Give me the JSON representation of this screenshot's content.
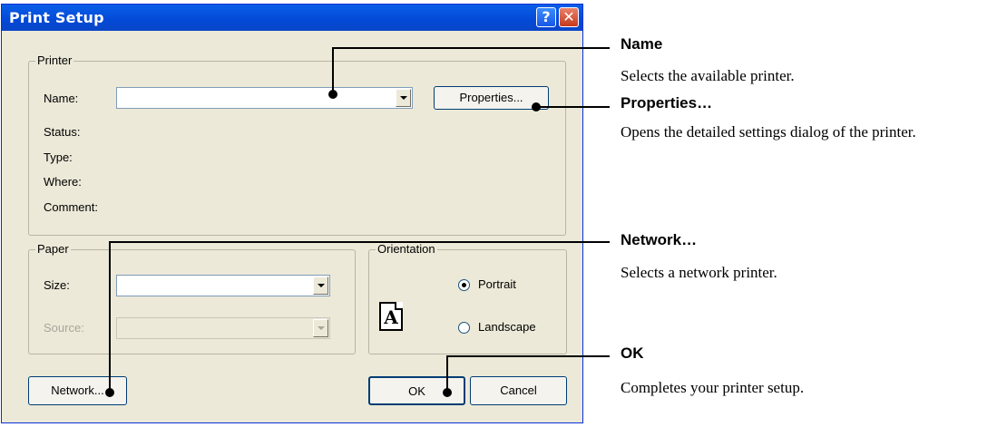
{
  "dialog": {
    "title": "Print Setup",
    "help_glyph": "?",
    "close_glyph": "✕"
  },
  "printer": {
    "group_label": "Printer",
    "name_label": "Name:",
    "name_value": "",
    "properties_label": "Properties...",
    "status_label": "Status:",
    "type_label": "Type:",
    "where_label": "Where:",
    "comment_label": "Comment:"
  },
  "paper": {
    "group_label": "Paper",
    "size_label": "Size:",
    "size_value": "",
    "source_label": "Source:",
    "source_value": ""
  },
  "orientation": {
    "group_label": "Orientation",
    "portrait_label": "Portrait",
    "landscape_label": "Landscape",
    "selected": "Portrait",
    "icon_glyph": "A"
  },
  "buttons": {
    "network": "Network...",
    "ok": "OK",
    "cancel": "Cancel"
  },
  "annotations": [
    {
      "title": "Name",
      "desc": "Selects the available printer."
    },
    {
      "title": "Properties…",
      "desc": "Opens the detailed settings dialog of the printer."
    },
    {
      "title": "Network…",
      "desc": "Selects a network printer."
    },
    {
      "title": "OK",
      "desc": "Completes your printer setup."
    }
  ],
  "colors": {
    "titlebar": "#0a5fe8",
    "dialog_bg": "#ece9d8",
    "button_border": "#003c74"
  }
}
